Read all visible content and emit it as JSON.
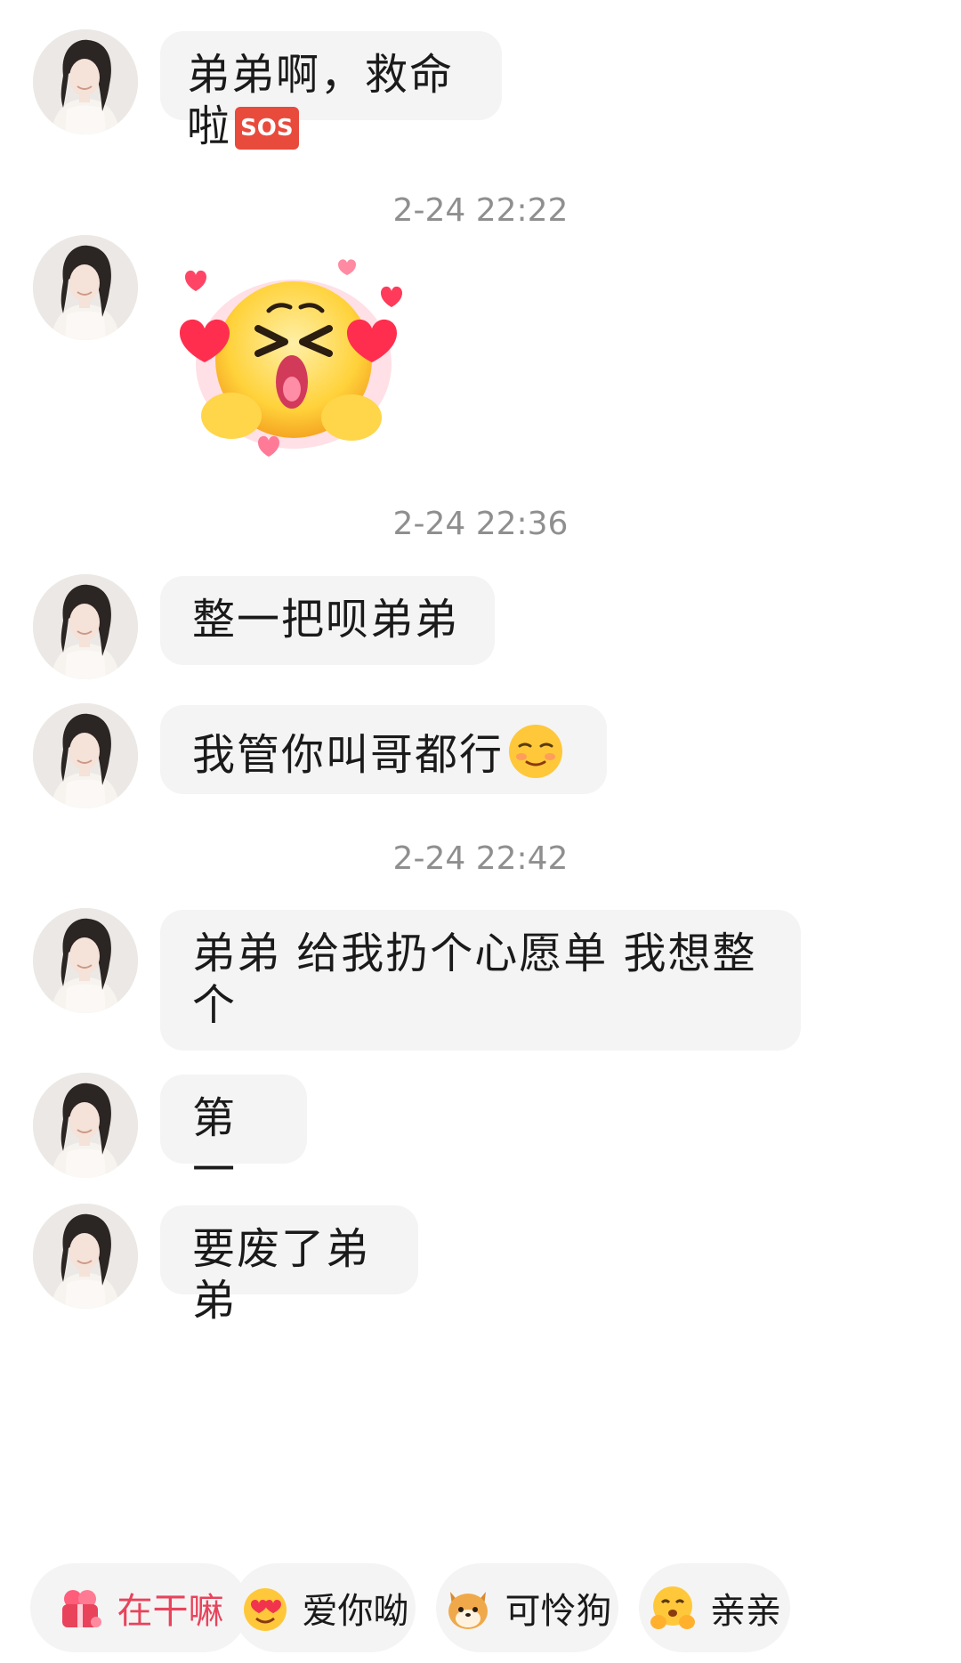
{
  "messages": [
    {
      "type": "text",
      "text": "弟弟啊，救命啦",
      "emoji": "SOS"
    },
    {
      "type": "time",
      "text": "2-24 22:22"
    },
    {
      "type": "sticker",
      "icon": "blushing-hearts-sticker-icon"
    },
    {
      "type": "time",
      "text": "2-24 22:36"
    },
    {
      "type": "text",
      "text": "整一把呗弟弟"
    },
    {
      "type": "text",
      "text": "我管你叫哥都行",
      "emoji": "relieved-face-icon"
    },
    {
      "type": "time",
      "text": "2-24 22:42"
    },
    {
      "type": "text",
      "line1": "弟弟 给我扔个心愿单 我想整",
      "line2": "个"
    },
    {
      "type": "text",
      "text": "第一"
    },
    {
      "type": "text",
      "text": "要废了弟弟"
    }
  ],
  "quick_replies": [
    {
      "label": "在干嘛",
      "icon": "gift-icon",
      "color": "#e8435b"
    },
    {
      "label": "爱你呦",
      "icon": "heart-eyes-icon"
    },
    {
      "label": "可怜狗",
      "icon": "shiba-dog-icon"
    },
    {
      "label": "亲亲",
      "icon": "hug-face-icon"
    }
  ]
}
